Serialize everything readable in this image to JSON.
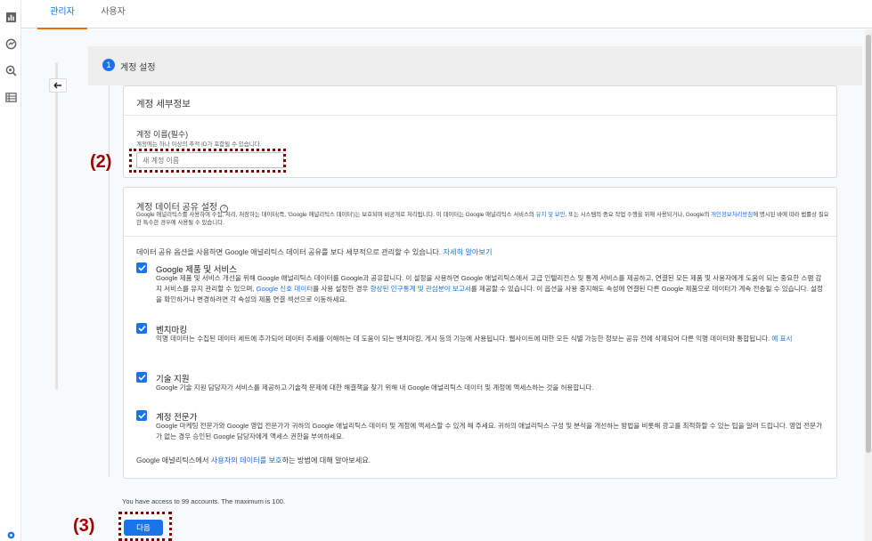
{
  "rail": {
    "icons": [
      "bar-chart-icon",
      "gauge-icon",
      "search-analytics-icon",
      "table-list-icon",
      "settings-icon"
    ]
  },
  "tabs": [
    {
      "label": "관리자",
      "active": true
    },
    {
      "label": "사용자",
      "active": false
    }
  ],
  "step": {
    "number": "1",
    "title": "계정 설정"
  },
  "account_details": {
    "heading": "계정 세부정보",
    "name_label": "계정 이름(필수)",
    "name_hint": "계정에는 하나 이상의 추적 ID가 포함될 수 있습니다.",
    "name_placeholder": "새 계정 이름"
  },
  "sharing": {
    "title": "계정 데이터 공유 설정",
    "help": "?",
    "desc_part1": "Google 애널리틱스를 사용하여 수집, 처리, 저장하는 데이터(즉, 'Google 애널리틱스 데이터')는 보호되며 비공개로 처리됩니다. 이 데이터는 Google 애널리틱스 서비스의 ",
    "desc_link1": "유지 및 보안",
    "desc_part2": ", 또는 시스템의 중요 작업 수행을 위해 사용되거나, Google의 ",
    "desc_link2": "개인정보처리방침",
    "desc_part3": "에 명시된 바에 따라 법률상 필요한 특수한 경우에 사용될 수 있습니다.",
    "intro": "데이터 공유 옵션을 사용하면 Google 애널리틱스 데이터 공유를 보다 세부적으로 관리할 수 있습니다. ",
    "intro_link": "자세히 알아보기",
    "options": [
      {
        "title": "Google 제품 및 서비스",
        "desc_a": "Google 제품 및 서비스 개선을 위해 Google 애널리틱스 데이터를 Google과 공유합니다. 이 설정을 사용하면 Google 애널리틱스에서 고급 인텔리전스 및 통계 서비스를 제공하고, 연결된 모든 제품 및 사용자에게 도움이 되는 중요한 스팸 감지 서비스를 유지 관리할 수 있으며, ",
        "link_a": "Google 신호 데이터",
        "desc_b": "를 사용 설정한 경우 ",
        "link_b": "향상된 인구통계 및 관심분야 보고서",
        "desc_c": "를 제공할 수 있습니다. 이 옵션을 사용 중지해도 속성에 연결된 다른 Google 제품으로 데이터가 계속 전송될 수 있습니다. 설정을 확인하거나 변경하려면 각 속성의 제품 연결 섹션으로 이동하세요."
      },
      {
        "title": "벤치마킹",
        "desc_a": "익명 데이터는 수집된 데이터 세트에 추가되어 데이터 추세를 이해하는 데 도움이 되는 벤치마킹, 게시 등의 기능에 사용됩니다. 웹사이트에 대한 모든 식별 가능한 정보는 공유 전에 삭제되어 다른 익명 데이터와 통합됩니다. ",
        "link_a": "예 표시"
      },
      {
        "title": "기술 지원",
        "desc_a": "Google 기술 지원 담당자가 서비스를 제공하고 기술적 문제에 대한 해결책을 찾기 위해 내 Google 애널리틱스 데이터 및 계정에 액세스하는 것을 허용합니다."
      },
      {
        "title": "계정 전문가",
        "desc_a": "Google 마케팅 전문가와 Google 영업 전문가가 귀하의 Google 애널리틱스 데이터 및 계정에 액세스할 수 있게 해 주세요. 귀하의 애널리틱스 구성 및 분석을 개선하는 방법을 비롯해 광고를 최적화할 수 있는 팁을 알려 드립니다. 영업 전문가가 없는 경우 승인된 Google 담당자에게 액세스 권한을 부여하세요."
      }
    ],
    "foot_a": "Google 애널리틱스에서 ",
    "foot_link": "사용자의 데이터를 보호",
    "foot_b": "하는 방법에 대해 알아보세요."
  },
  "access_note": "You have access to 99 accounts. The maximum is 100.",
  "next_button": "다음",
  "annotations": {
    "label2": "(2)",
    "label3": "(3)",
    "color": "#8b0000"
  },
  "colors": {
    "accent": "#1a73e8",
    "tab_underline": "#e8710a"
  }
}
